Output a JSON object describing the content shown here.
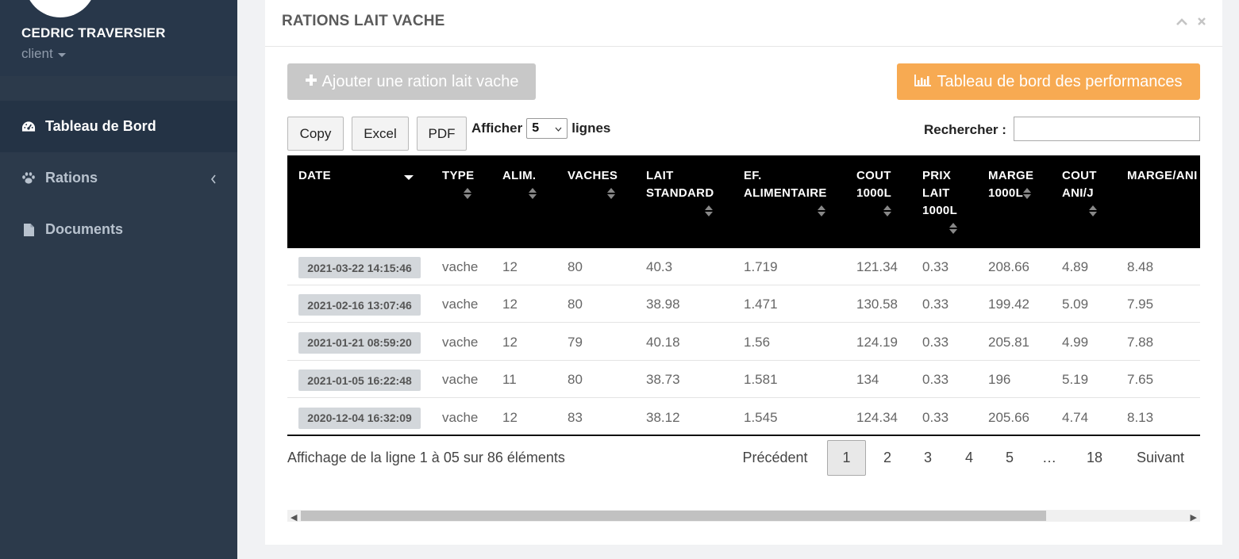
{
  "user": {
    "name": "CEDRIC TRAVERSIER",
    "role": "client"
  },
  "sidebar": {
    "items": [
      {
        "label": "Tableau de Bord",
        "icon": "dashboard-gauge-icon"
      },
      {
        "label": "Rations",
        "icon": "paw-icon"
      },
      {
        "label": "Documents",
        "icon": "file-icon"
      }
    ]
  },
  "panel": {
    "title": "RATIONS LAIT VACHE",
    "add_button": "Ajouter une ration lait vache",
    "perf_button": "Tableau de bord des performances"
  },
  "toolbar": {
    "copy": "Copy",
    "excel": "Excel",
    "pdf": "PDF",
    "show_prefix": "Afficher",
    "show_value": "5",
    "show_suffix": "lignes",
    "search_label": "Rechercher :",
    "search_value": ""
  },
  "table": {
    "headers": {
      "date": "DATE",
      "type": "TYPE",
      "alim": "ALIM.",
      "vaches": "VACHES",
      "lait_1": "LAIT",
      "lait_2": "STANDARD",
      "ef_1": "EF.",
      "ef_2": "ALIMENTAIRE",
      "cout_1": "COUT",
      "cout_2": "1000L",
      "prix_1": "PRIX",
      "prix_2": "LAIT",
      "prix_3": "1000L",
      "marge_1": "MARGE",
      "marge_2": "1000L",
      "coutani_1": "COUT",
      "coutani_2": "ANI/J",
      "margeani": "MARGE/ANI"
    },
    "rows": [
      {
        "date": "2021-03-22 14:15:46",
        "type": "vache",
        "alim": "12",
        "vaches": "80",
        "lait": "40.3",
        "ef": "1.719",
        "cout": "121.34",
        "prix": "0.33",
        "marge": "208.66",
        "coutani": "4.89",
        "margeani": "8.48"
      },
      {
        "date": "2021-02-16 13:07:46",
        "type": "vache",
        "alim": "12",
        "vaches": "80",
        "lait": "38.98",
        "ef": "1.471",
        "cout": "130.58",
        "prix": "0.33",
        "marge": "199.42",
        "coutani": "5.09",
        "margeani": "7.95"
      },
      {
        "date": "2021-01-21 08:59:20",
        "type": "vache",
        "alim": "12",
        "vaches": "79",
        "lait": "40.18",
        "ef": "1.56",
        "cout": "124.19",
        "prix": "0.33",
        "marge": "205.81",
        "coutani": "4.99",
        "margeani": "7.88"
      },
      {
        "date": "2021-01-05 16:22:48",
        "type": "vache",
        "alim": "11",
        "vaches": "80",
        "lait": "38.73",
        "ef": "1.581",
        "cout": "134",
        "prix": "0.33",
        "marge": "196",
        "coutani": "5.19",
        "margeani": "7.65"
      },
      {
        "date": "2020-12-04 16:32:09",
        "type": "vache",
        "alim": "12",
        "vaches": "83",
        "lait": "38.12",
        "ef": "1.545",
        "cout": "124.34",
        "prix": "0.33",
        "marge": "205.66",
        "coutani": "4.74",
        "margeani": "8.13"
      }
    ]
  },
  "footer": {
    "info": "Affichage de la ligne 1 à 05 sur 86 éléments",
    "prev": "Précédent",
    "pages": [
      "1",
      "2",
      "3",
      "4",
      "5",
      "…",
      "18"
    ],
    "next": "Suivant"
  },
  "colors": {
    "sidebar": "#2c3a4b",
    "accent_orange": "#f7aa52",
    "table_header": "#000000",
    "disabled_button": "#c8c8c8"
  }
}
